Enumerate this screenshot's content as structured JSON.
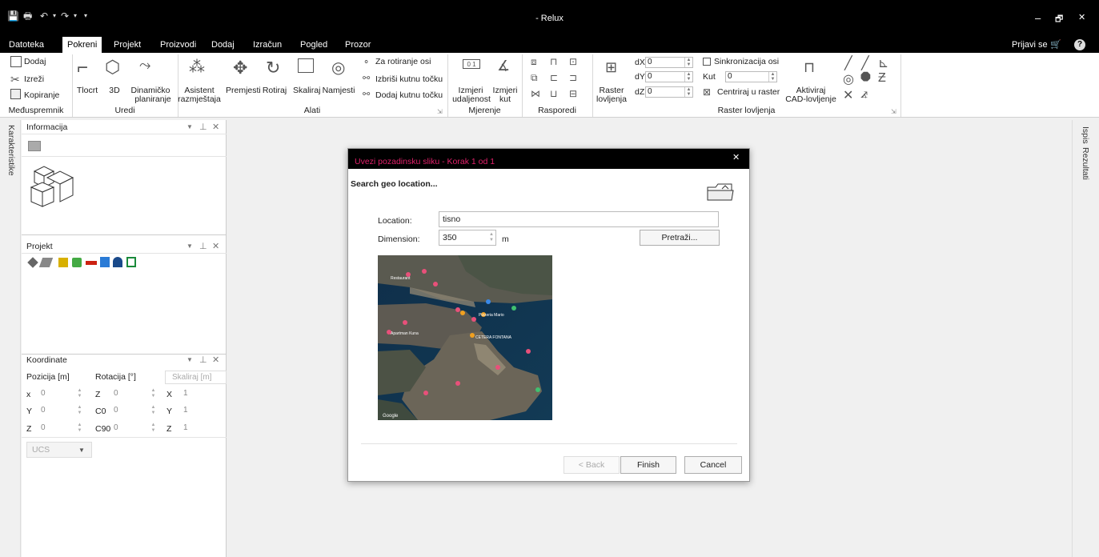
{
  "window": {
    "title": "- Relux",
    "minimize": "–",
    "maximize": "🗗",
    "close": "✕"
  },
  "quick_access": {
    "save": "💾",
    "print": "🖶",
    "undo": "↶",
    "redo": "↷",
    "more": "▾"
  },
  "menu": {
    "items": [
      "Datoteka",
      "Pokreni",
      "Projekt",
      "Proizvodi",
      "Dodaj",
      "Izračun",
      "Pogled",
      "Prozor"
    ],
    "active_index": 1,
    "login": "Prijavi se"
  },
  "ribbon": {
    "clipboard": {
      "add": "Dodaj",
      "cut": "Izreži",
      "copy": "Kopiranje",
      "group": "Međuspremnik"
    },
    "edit": {
      "floorplan": "Tlocrt",
      "three_d": "3D",
      "dynamic_line1": "Dinamičko",
      "dynamic_line2": "planiranje",
      "group": "Uredi"
    },
    "tools": {
      "assistant_line1": "Asistent",
      "assistant_line2": "razmještaja",
      "move": "Premjesti",
      "rotate": "Rotiraj",
      "scale": "Skaliraj",
      "set": "Namjesti",
      "rotate_axis": "Za rotiranje osi",
      "delete_corner": "Izbriši kutnu točku",
      "add_corner": "Dodaj kutnu točku",
      "group": "Alati"
    },
    "measure": {
      "distance_line1": "Izmjeri",
      "distance_line2": "udaljenost",
      "angle_line1": "Izmjeri",
      "angle_line2": "kut",
      "group": "Mjerenje"
    },
    "arrange": {
      "group": "Rasporedi"
    },
    "snap": {
      "raster_line1": "Raster",
      "raster_line2": "lovljenja",
      "dx_label": "dX",
      "dx_value": "0",
      "dy_label": "dY",
      "dy_value": "0",
      "dz_label": "dZ",
      "dz_value": "0",
      "sync_axis": "Sinkronizacija osi",
      "angle_label": "Kut",
      "angle_value": "0",
      "center": "Centriraj u raster",
      "cad_line1": "Aktiviraj",
      "cad_line2": "CAD-lovljenje",
      "group": "Raster lovljenja"
    }
  },
  "side_tabs": {
    "left": "Karakteristike",
    "right1": "Ispis",
    "right2": "Rezultati"
  },
  "panels": {
    "info": {
      "title": "Informacija"
    },
    "project": {
      "title": "Projekt"
    },
    "coords": {
      "title": "Koordinate",
      "position_header": "Pozicija [m]",
      "rotation_header": "Rotacija [°]",
      "scale_header": "Skaliraj [m]",
      "rows": [
        {
          "pos_label": "x",
          "pos_value": "0",
          "rot_label": "Z",
          "rot_value": "0",
          "scale_label": "X",
          "scale_value": "1"
        },
        {
          "pos_label": "Y",
          "pos_value": "0",
          "rot_label": "C0",
          "rot_value": "0",
          "scale_label": "Y",
          "scale_value": "1"
        },
        {
          "pos_label": "Z",
          "pos_value": "0",
          "rot_label": "C90",
          "rot_value": "0",
          "scale_label": "Z",
          "scale_value": "1"
        }
      ],
      "ucs": "UCS"
    },
    "controls": {
      "dropdown": "▼",
      "pin": "⊥",
      "close": "✕"
    }
  },
  "dialog": {
    "title": "Uvezi pozadinsku sliku - Korak 1 od 1",
    "close": "✕",
    "heading": "Search geo location...",
    "location_label": "Location:",
    "location_value": "tisno",
    "dimension_label": "Dimension:",
    "dimension_value": "350",
    "dimension_unit": "m",
    "search_button": "Pretraži...",
    "map_labels": [
      "Restaurant",
      "Pizzeria Mario",
      "CETERA FONTANA",
      "Apartman Kuna",
      "Google"
    ],
    "back": "< Back",
    "finish": "Finish",
    "cancel": "Cancel",
    "colors": {
      "title": "#e0206a",
      "header_bg": "#000000"
    }
  }
}
